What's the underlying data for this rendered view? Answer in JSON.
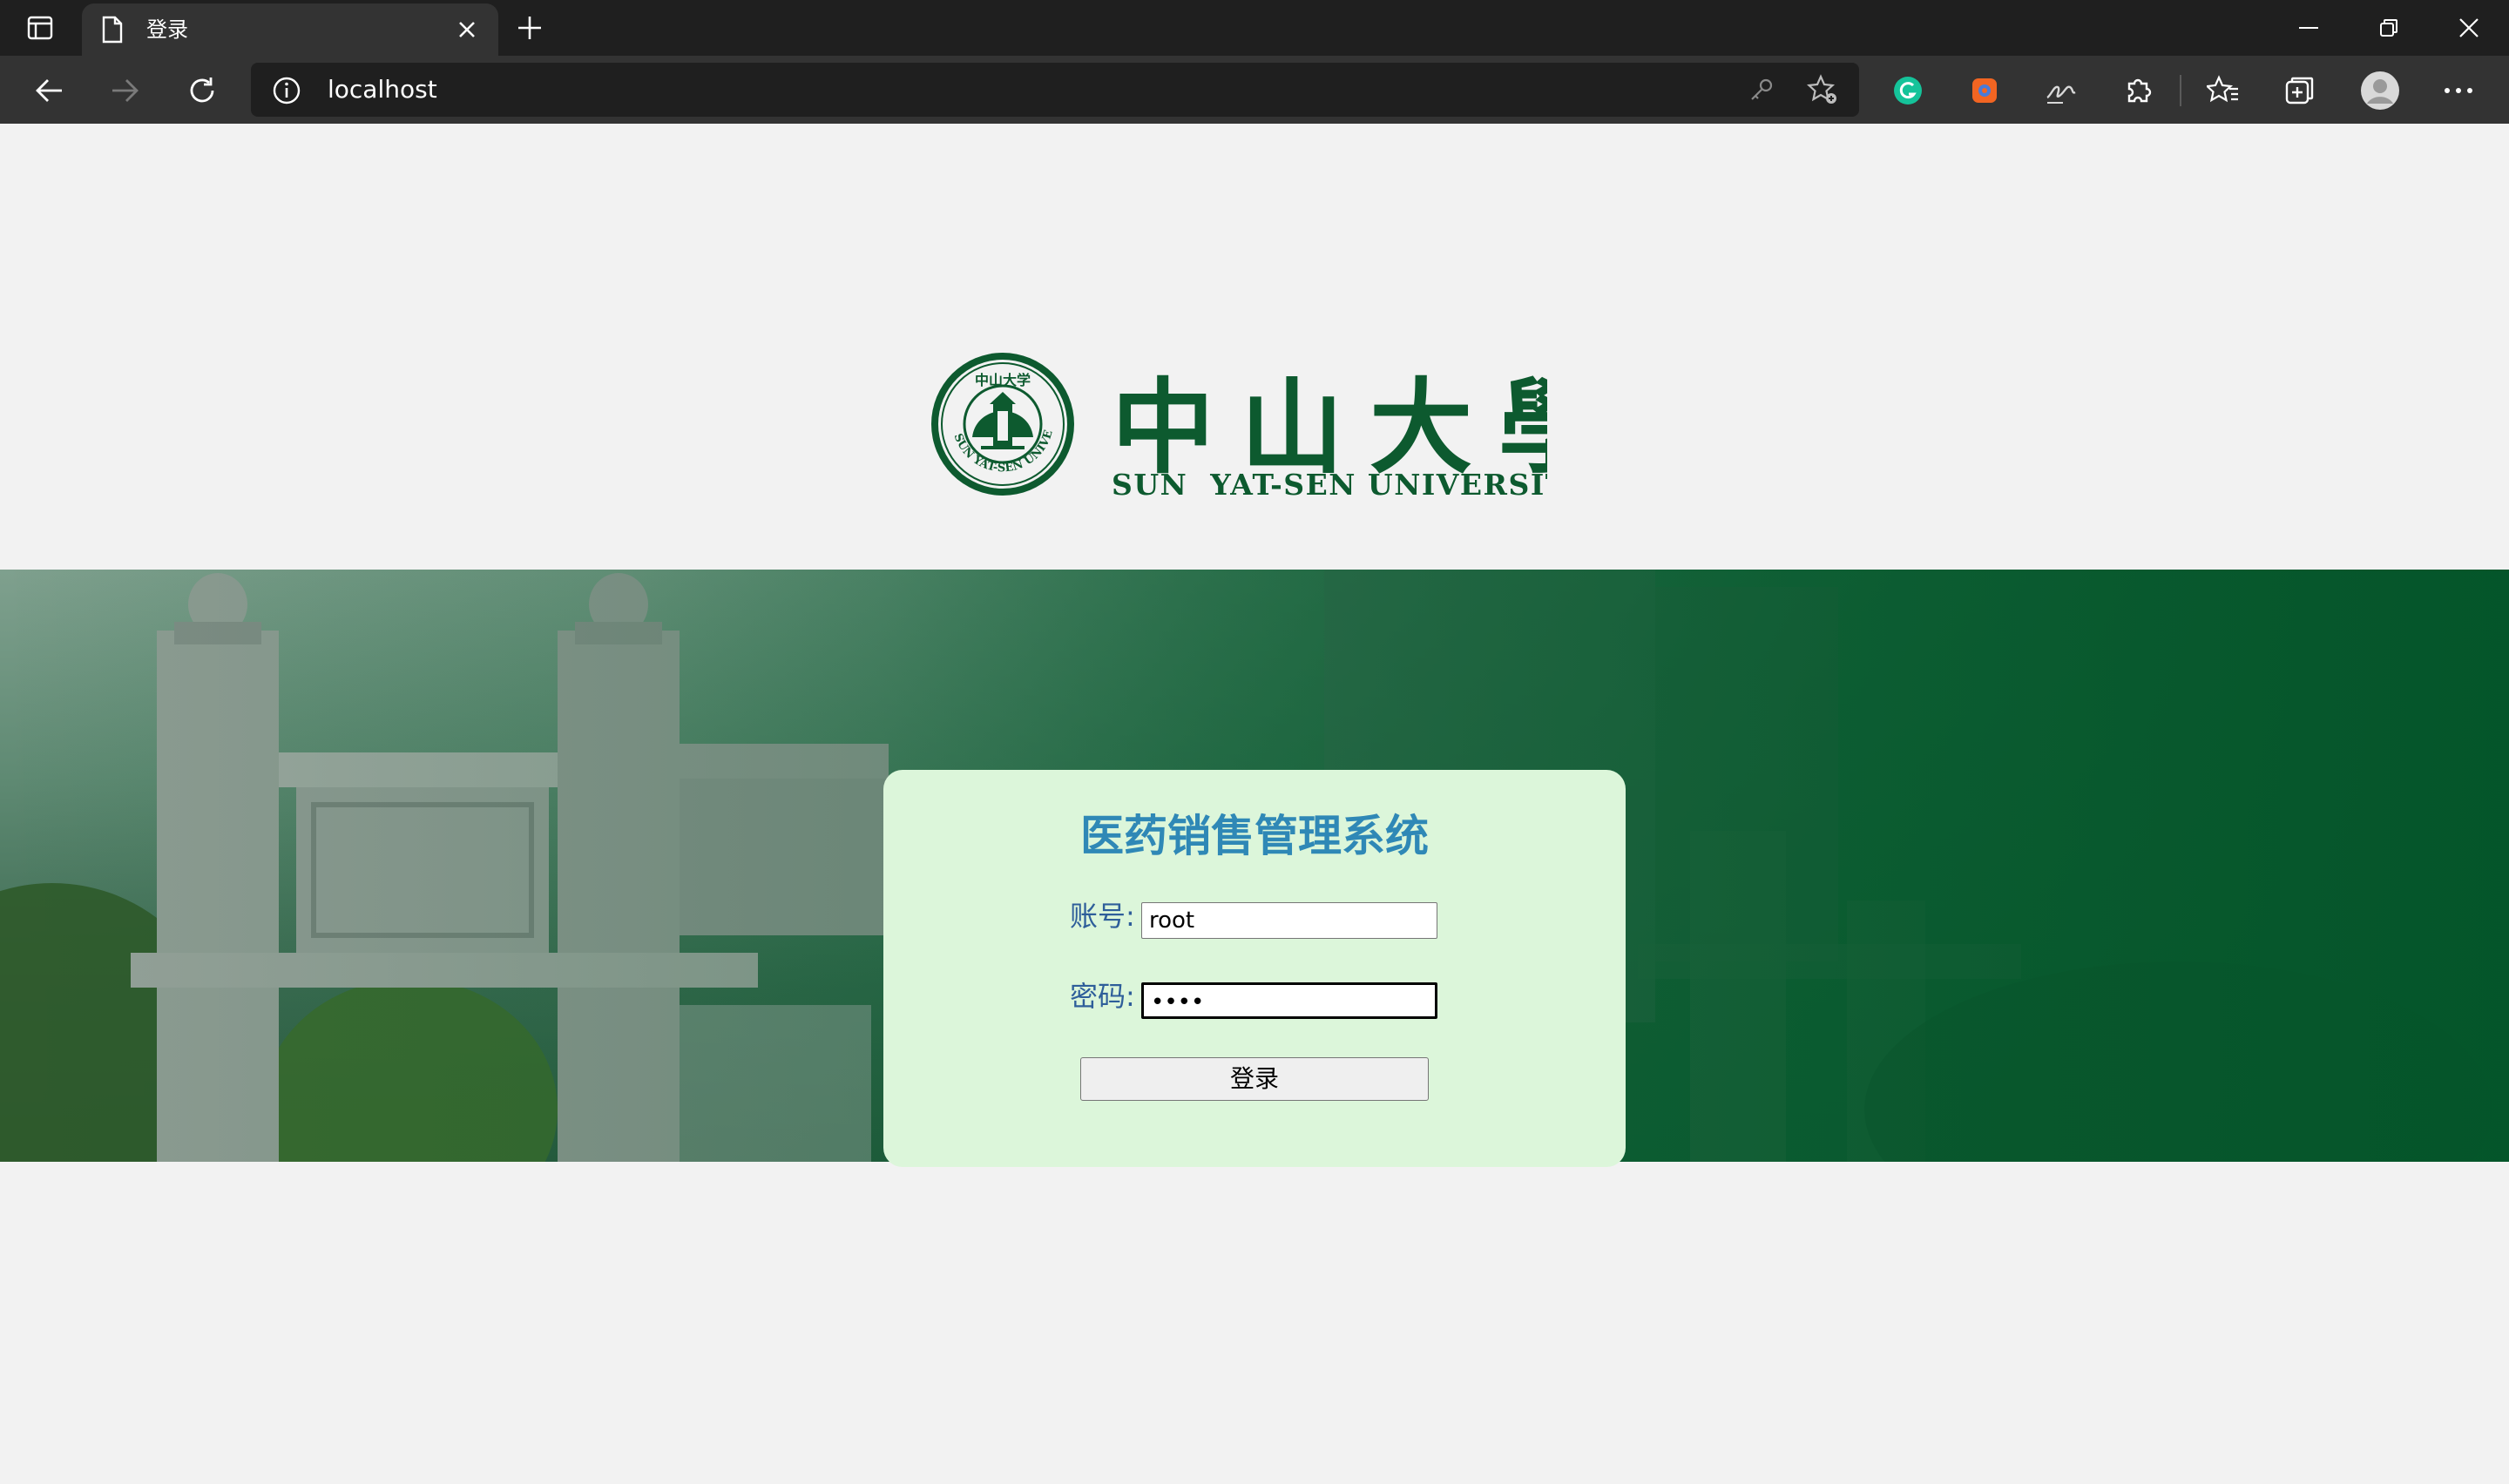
{
  "browser": {
    "tab_title": "登录",
    "address": "localhost"
  },
  "logo": {
    "chinese_name": "中山大學",
    "english_name": "SUN  YAT-SEN UNIVERSITY",
    "seal_text": "SUN YAT-SEN UNIVERSITY",
    "seal_chinese": "中山大学"
  },
  "login": {
    "title": "医药销售管理系统",
    "username_label": "账号:",
    "username_value": "root",
    "password_label": "密码:",
    "password_value": "••••",
    "submit_label": "登录"
  },
  "colors": {
    "title": "#2f88b6",
    "card": "#dcf6da",
    "brand_green": "#0d5a2f"
  }
}
